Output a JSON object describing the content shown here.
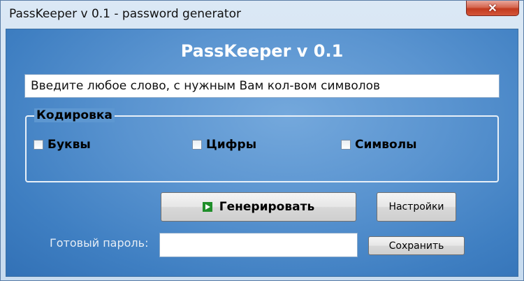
{
  "window": {
    "title": "PassKeeper v 0.1 - password generator",
    "close_glyph": "✕"
  },
  "app": {
    "heading": "PassKeeper v 0.1",
    "word_input_value": "Введите любое слово, с нужным Вам кол-вом символов"
  },
  "encoding": {
    "group_label": "Кодировка",
    "options": [
      {
        "label": "Буквы",
        "checked": false
      },
      {
        "label": "Цифры",
        "checked": false
      },
      {
        "label": "Символы",
        "checked": false
      }
    ]
  },
  "buttons": {
    "generate_label": "Генерировать",
    "generate_icon": "play-icon",
    "settings_label": "Настройки",
    "save_label": "Сохранить"
  },
  "output": {
    "label": "Готовый пароль:",
    "value": ""
  },
  "colors": {
    "accent_blue": "#3f7fc2",
    "close_red": "#c23a1e",
    "play_green": "#1f8e2a"
  }
}
